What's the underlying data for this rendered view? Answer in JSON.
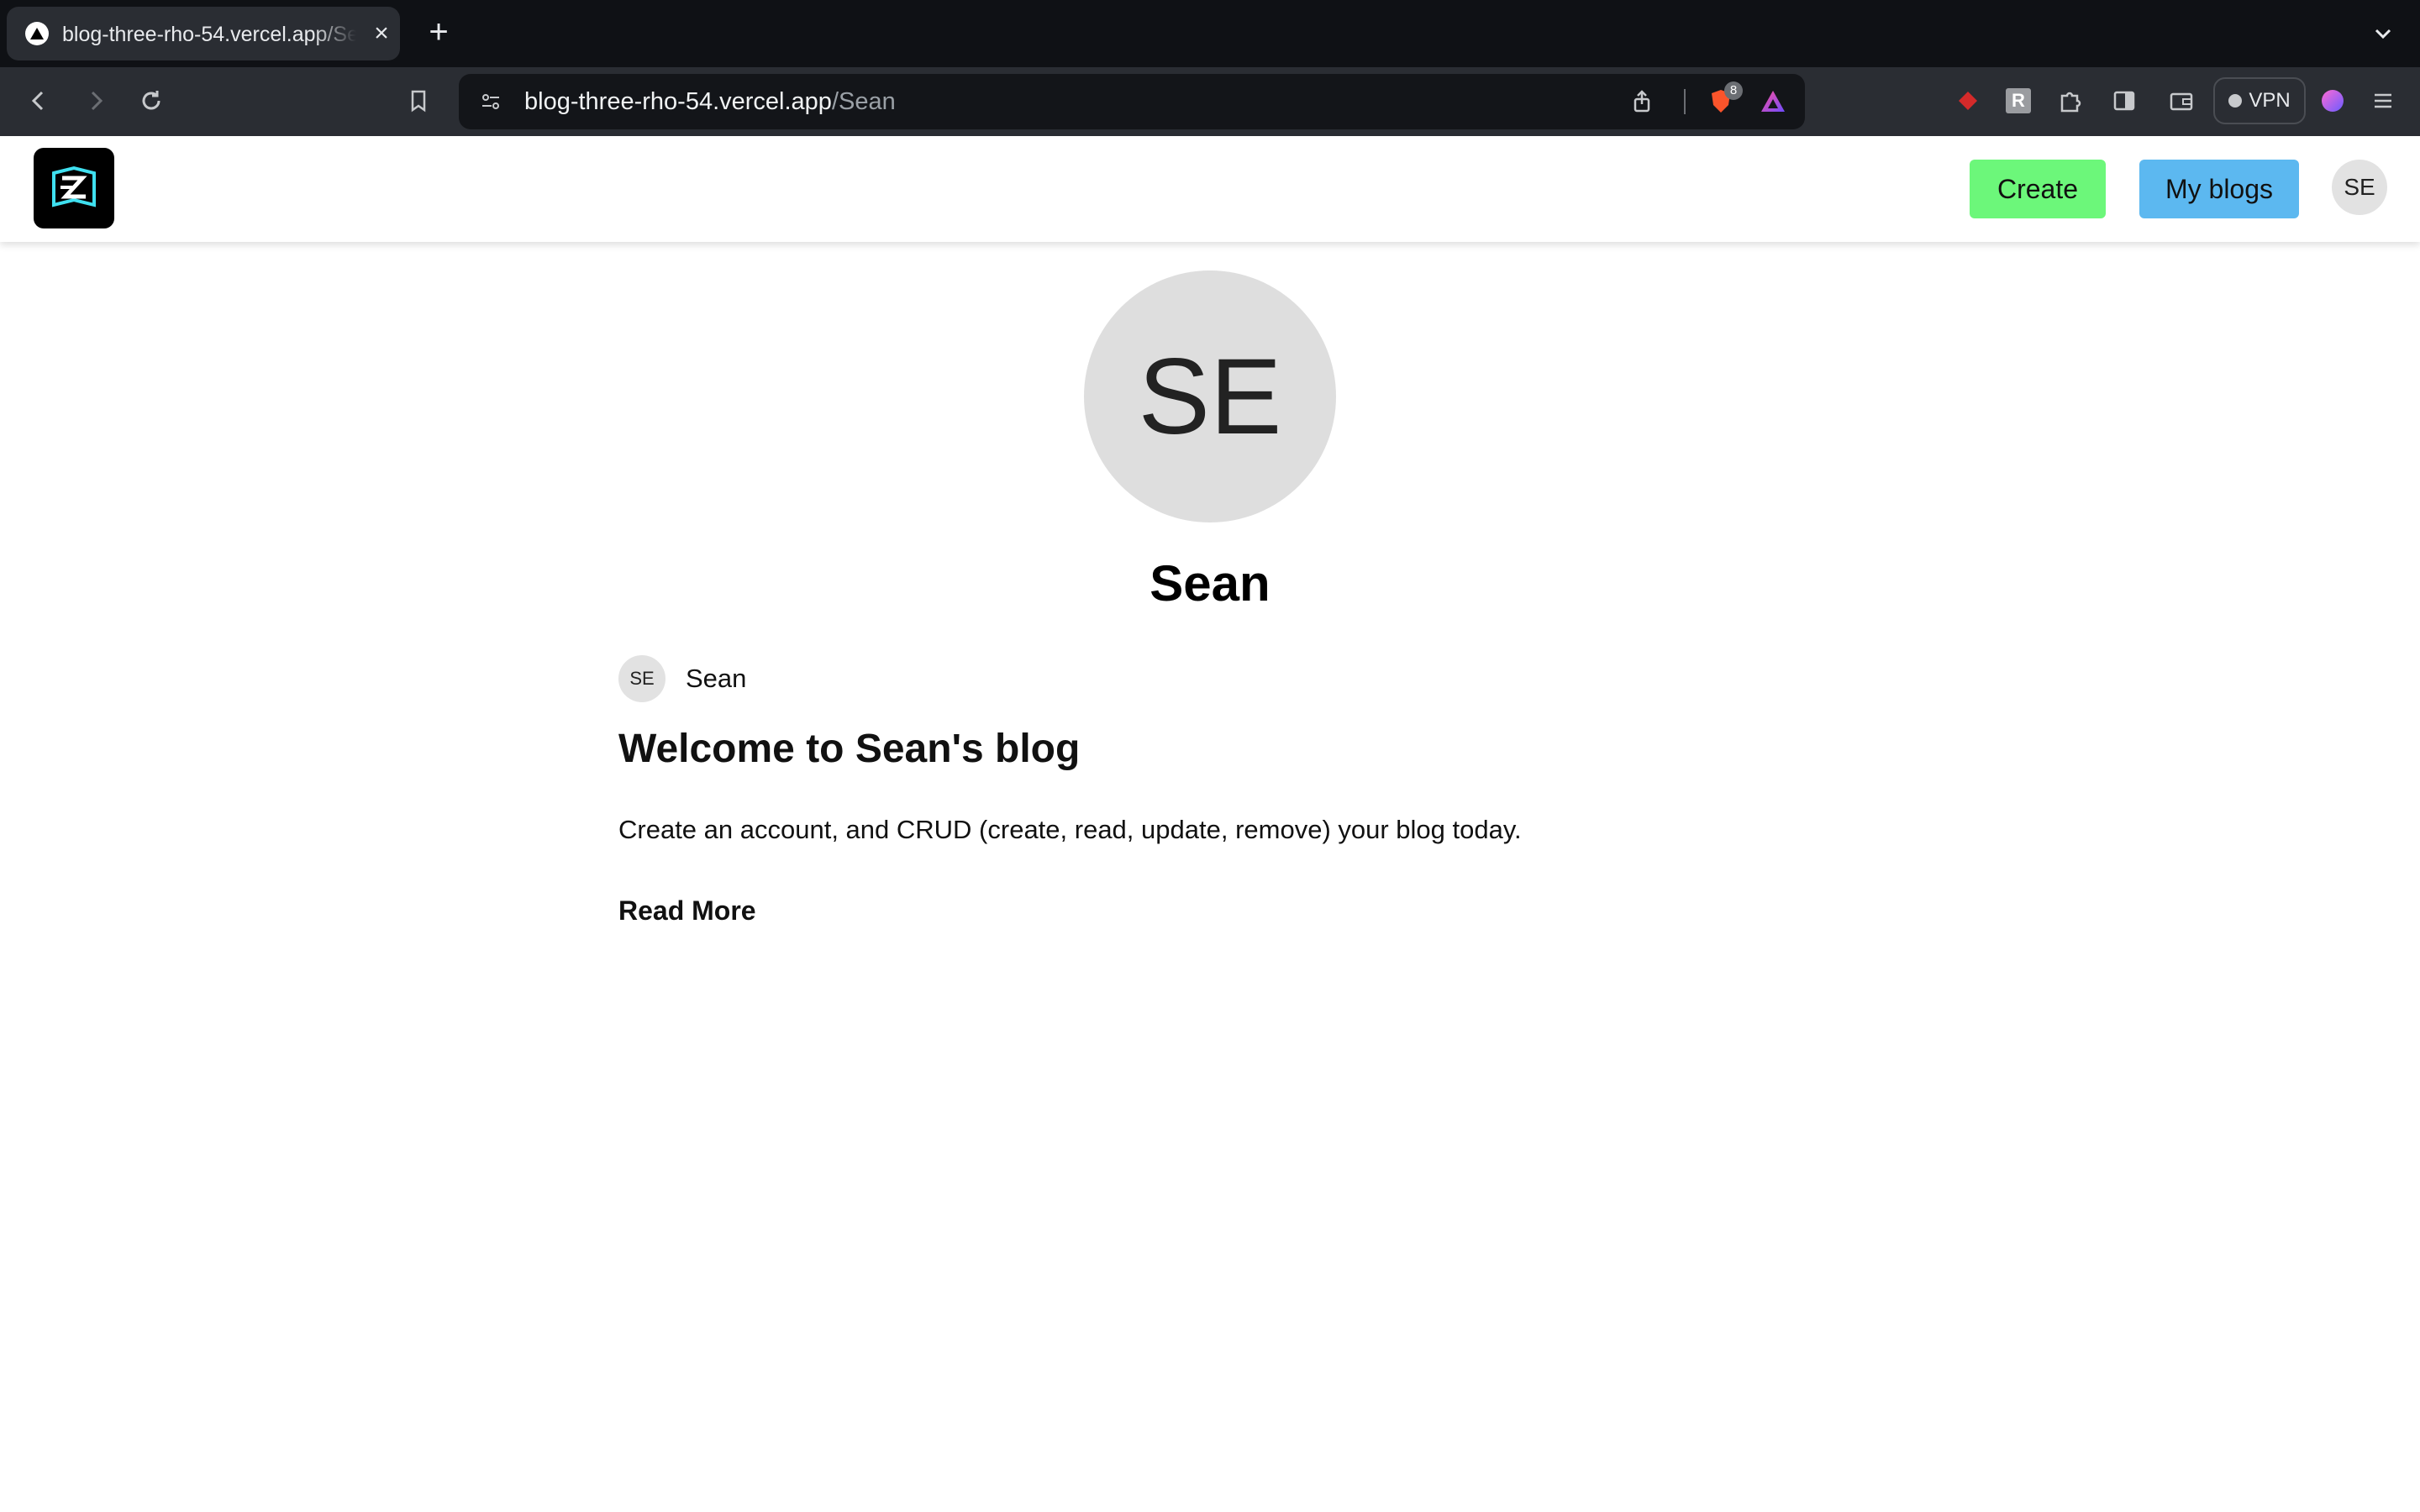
{
  "browser": {
    "tab_title": "blog-three-rho-54.vercel.app/Sean",
    "url_domain": "blog-three-rho-54.vercel.app",
    "url_path": "/Sean",
    "shields_count": "8",
    "vpn_label": "VPN",
    "extension_letter": "R"
  },
  "header": {
    "create_label": "Create",
    "my_blogs_label": "My blogs",
    "avatar_initials": "SE",
    "logo_icon": "ez-book-logo"
  },
  "profile": {
    "initials": "SE",
    "name": "Sean"
  },
  "posts": [
    {
      "author_initials": "SE",
      "author_name": "Sean",
      "title": "Welcome to Sean's blog",
      "excerpt": "Create an account, and CRUD (create, read, update, remove) your blog today.",
      "read_more": "Read More"
    }
  ],
  "colors": {
    "create_button": "#6cf77a",
    "my_blogs_button": "#5cb8f0",
    "avatar_bg": "#dedede"
  }
}
